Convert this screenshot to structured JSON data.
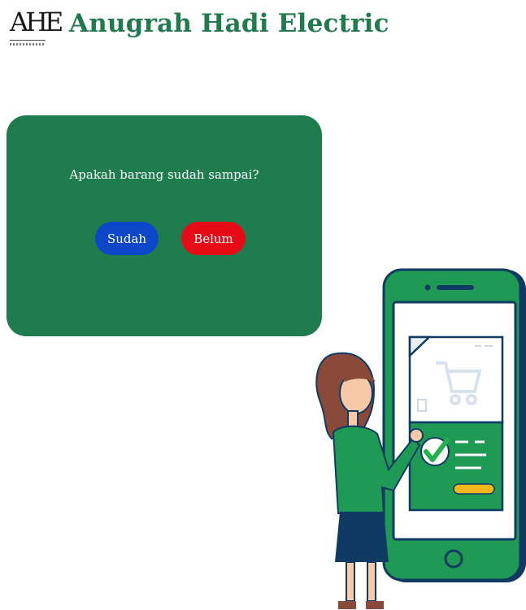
{
  "header": {
    "logo_text": "AHE",
    "brand_name": "Anugrah Hadi Electric"
  },
  "confirm": {
    "question": "Apakah barang sudah sampai?",
    "yes_label": "Sudah",
    "no_label": "Belum"
  },
  "colors": {
    "brand_green": "#1f7a4c",
    "card_green": "#1f7d4d",
    "yes_button": "#0d47c9",
    "no_button": "#e60c17"
  },
  "illustration": {
    "icon": "woman-confirming-delivery-on-phone-illustration"
  }
}
